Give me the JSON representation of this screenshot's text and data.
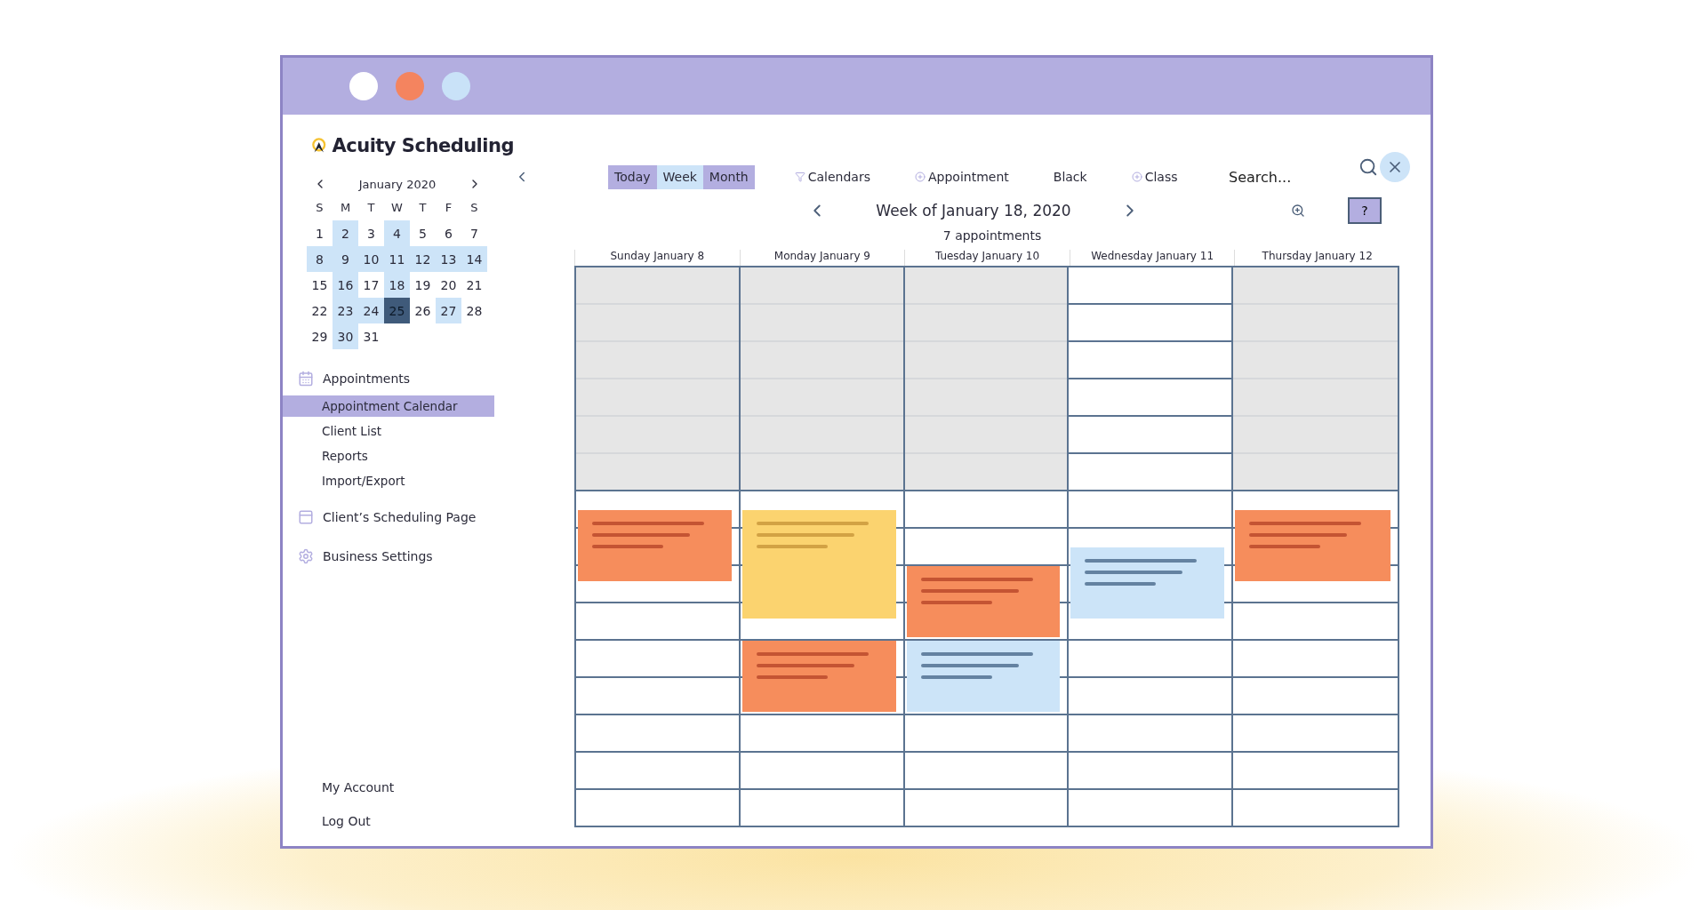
{
  "window": {
    "controls": [
      {
        "color": "#ffffff"
      },
      {
        "color": "#f4845f"
      },
      {
        "color": "#c9e2f8"
      }
    ]
  },
  "brand": {
    "name": "Acuity Scheduling"
  },
  "mini_calendar": {
    "month": "January 2020",
    "weekdays": [
      "S",
      "M",
      "T",
      "W",
      "T",
      "F",
      "S"
    ],
    "weeks": [
      [
        {
          "label": "1",
          "highlighted": false,
          "selected": false
        },
        {
          "label": "2",
          "highlighted": true,
          "selected": false
        },
        {
          "label": "3",
          "highlighted": false,
          "selected": false
        },
        {
          "label": "4",
          "highlighted": true,
          "selected": false
        },
        {
          "label": "5",
          "highlighted": false,
          "selected": false
        },
        {
          "label": "6",
          "highlighted": false,
          "selected": false
        },
        {
          "label": "7",
          "highlighted": false,
          "selected": false
        }
      ],
      [
        {
          "label": "8",
          "highlighted": true,
          "selected": false
        },
        {
          "label": "9",
          "highlighted": true,
          "selected": false
        },
        {
          "label": "10",
          "highlighted": true,
          "selected": false
        },
        {
          "label": "11",
          "highlighted": true,
          "selected": false
        },
        {
          "label": "12",
          "highlighted": true,
          "selected": false
        },
        {
          "label": "13",
          "highlighted": true,
          "selected": false
        },
        {
          "label": "14",
          "highlighted": true,
          "selected": false
        }
      ],
      [
        {
          "label": "15",
          "highlighted": false,
          "selected": false
        },
        {
          "label": "16",
          "highlighted": true,
          "selected": false
        },
        {
          "label": "17",
          "highlighted": false,
          "selected": false
        },
        {
          "label": "18",
          "highlighted": true,
          "selected": false
        },
        {
          "label": "19",
          "highlighted": false,
          "selected": false
        },
        {
          "label": "20",
          "highlighted": false,
          "selected": false
        },
        {
          "label": "21",
          "highlighted": false,
          "selected": false
        }
      ],
      [
        {
          "label": "22",
          "highlighted": false,
          "selected": false
        },
        {
          "label": "23",
          "highlighted": true,
          "selected": false
        },
        {
          "label": "24",
          "highlighted": true,
          "selected": false
        },
        {
          "label": "25",
          "highlighted": true,
          "selected": true
        },
        {
          "label": "26",
          "highlighted": false,
          "selected": false
        },
        {
          "label": "27",
          "highlighted": true,
          "selected": false
        },
        {
          "label": "28",
          "highlighted": false,
          "selected": false
        }
      ],
      [
        {
          "label": "29",
          "highlighted": false,
          "selected": false
        },
        {
          "label": "30",
          "highlighted": true,
          "selected": false
        },
        {
          "label": "31",
          "highlighted": false,
          "selected": false
        }
      ]
    ]
  },
  "sidebar": {
    "sections": [
      {
        "kind": "calendar",
        "label": "Appointments",
        "items": [
          {
            "label": "Appointment Calendar",
            "selected": true
          },
          {
            "label": "Client List",
            "selected": false
          },
          {
            "label": "Reports",
            "selected": false
          },
          {
            "label": "Import/Export",
            "selected": false
          }
        ]
      },
      {
        "kind": "page",
        "label": "Client’s Scheduling Page"
      },
      {
        "kind": "settings",
        "label": "Business Settings"
      }
    ],
    "footer": [
      {
        "label": "My Account"
      },
      {
        "label": "Log Out"
      }
    ]
  },
  "toolbar": {
    "views": [
      {
        "label": "Today",
        "selected": false
      },
      {
        "label": "Week",
        "selected": true
      },
      {
        "label": "Month",
        "selected": false
      }
    ],
    "actions": [
      {
        "kind": "filter",
        "label": "Calendars"
      },
      {
        "kind": "add",
        "label": "Appointment"
      },
      {
        "kind": "plain",
        "label": "Black"
      },
      {
        "kind": "add",
        "label": "Class"
      }
    ],
    "search": {
      "placeholder": "Search..."
    },
    "help": "?"
  },
  "week": {
    "title": "Week of January 18, 2020",
    "count": "7 appointments"
  },
  "days": [
    {
      "label": "Sunday January 8",
      "closed_morning": true,
      "events": [
        {
          "color": "#f68d5c"
        }
      ]
    },
    {
      "label": "Monday January 9",
      "closed_morning": true,
      "events": [
        {
          "color": "#fbd36f"
        },
        {
          "color": "#f68d5c"
        }
      ]
    },
    {
      "label": "Tuesday January 10",
      "closed_morning": true,
      "events": [
        {
          "color": "#f68d5c"
        },
        {
          "color": "#cce4f8"
        }
      ]
    },
    {
      "label": "Wednesday January 11",
      "closed_morning": false,
      "events": [
        {
          "color": "#cce4f8"
        }
      ]
    },
    {
      "label": "Thursday January 12",
      "closed_morning": true,
      "events": [
        {
          "color": "#f68d5c"
        }
      ]
    }
  ]
}
